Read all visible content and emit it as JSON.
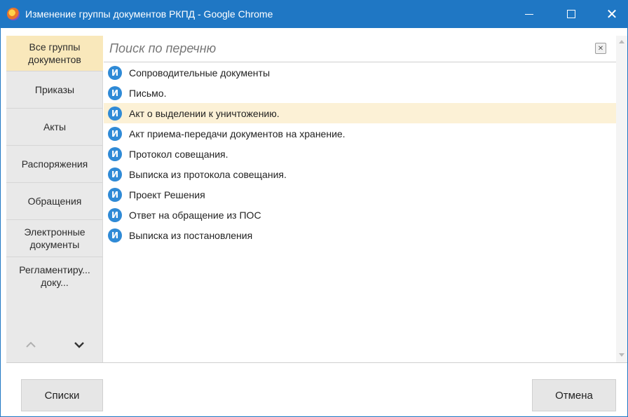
{
  "window": {
    "title": "Изменение группы документов РКПД - Google Chrome"
  },
  "nav": {
    "items": [
      {
        "label": "Все группы документов",
        "active": true
      },
      {
        "label": "Приказы",
        "active": false
      },
      {
        "label": "Акты",
        "active": false
      },
      {
        "label": "Распоряжения",
        "active": false
      },
      {
        "label": "Обращения",
        "active": false
      },
      {
        "label": "Электронные документы",
        "active": false
      },
      {
        "label": "Регламентиру... доку...",
        "active": false
      }
    ]
  },
  "search": {
    "placeholder": "Поиск по перечню",
    "value": ""
  },
  "list": {
    "badge_letter": "И",
    "items": [
      {
        "label": "Сопроводительные документы",
        "selected": false
      },
      {
        "label": "Письмо.",
        "selected": false
      },
      {
        "label": "Акт о выделении к уничтожению.",
        "selected": true
      },
      {
        "label": "Акт приема-передачи документов на хранение.",
        "selected": false
      },
      {
        "label": "Протокол совещания.",
        "selected": false
      },
      {
        "label": "Выписка из протокола совещания.",
        "selected": false
      },
      {
        "label": "Проект Решения",
        "selected": false
      },
      {
        "label": "Ответ на обращение из ПОС",
        "selected": false
      },
      {
        "label": "Выписка из постановления",
        "selected": false
      }
    ]
  },
  "footer": {
    "lists_label": "Списки",
    "cancel_label": "Отмена"
  },
  "colors": {
    "titlebar": "#1f77c4",
    "active_nav": "#f9e8bb",
    "selected_row": "#fcf1d6",
    "badge": "#2f8ad6"
  }
}
